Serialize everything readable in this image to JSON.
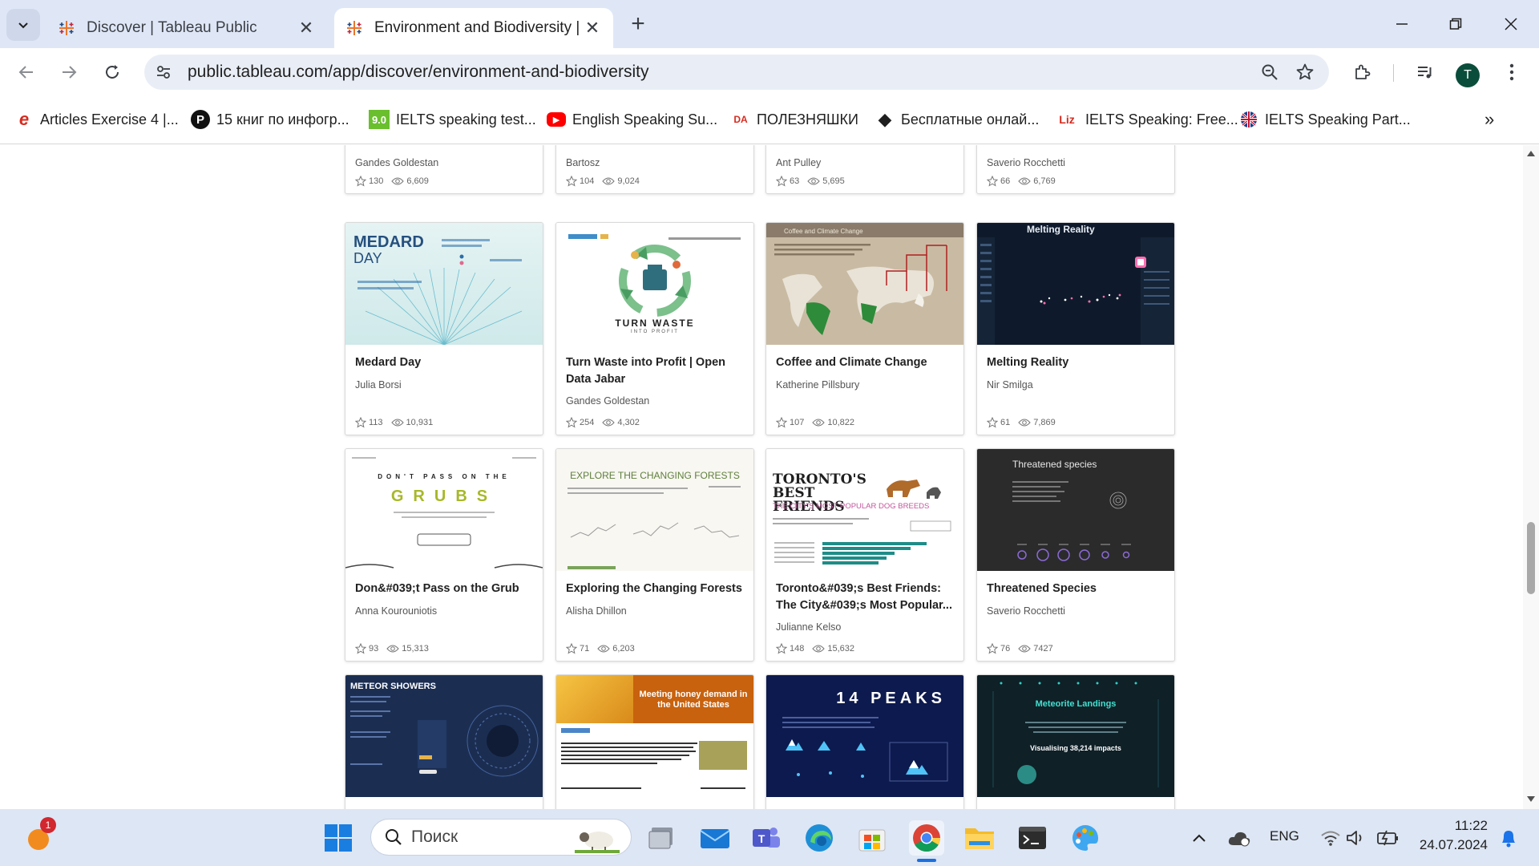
{
  "browser": {
    "tabs": [
      {
        "title": "Discover | Tableau Public",
        "active": false
      },
      {
        "title": "Environment and Biodiversity | T",
        "active": true
      }
    ],
    "url": "public.tableau.com/app/discover/environment-and-biodiversity",
    "avatar_letter": "T",
    "bookmarks": [
      {
        "label": "Articles Exercise 4 |...",
        "icon": "e",
        "color": "#d62b1f"
      },
      {
        "label": "15 книг по инфогр...",
        "icon": "P",
        "color": "#111111"
      },
      {
        "label": "IELTS speaking test...",
        "icon": "9.0",
        "color": "#6abf2e"
      },
      {
        "label": "English Speaking Su...",
        "icon": "▶",
        "color": "#ff0000"
      },
      {
        "label": "ПОЛЕЗНЯШКИ",
        "icon": "DA",
        "color": "#d62b1f"
      },
      {
        "label": "Бесплатные онлай...",
        "icon": "◆",
        "color": "#111111"
      },
      {
        "label": "IELTS Speaking: Free...",
        "icon": "Liz",
        "color": "#d62b1f"
      },
      {
        "label": "IELTS Speaking Part...",
        "icon": "🇬🇧",
        "color": "#1a3f8f"
      }
    ]
  },
  "gallery": {
    "row0": [
      {
        "author": "Gandes Goldestan",
        "favorites": "130",
        "views": "6,609"
      },
      {
        "author": "Bartosz",
        "favorites": "104",
        "views": "9,024"
      },
      {
        "author": "Ant Pulley",
        "favorites": "63",
        "views": "5,695"
      },
      {
        "author": "Saverio Rocchetti",
        "favorites": "66",
        "views": "6,769"
      }
    ],
    "row1": [
      {
        "title": "Medard Day",
        "author": "Julia Borsi",
        "favorites": "113",
        "views": "10,931",
        "thumb_title": "MEDARD",
        "thumb_sub": "DAY"
      },
      {
        "title": "Turn Waste into Profit | Open Data Jabar",
        "author": "Gandes Goldestan",
        "favorites": "254",
        "views": "4,302",
        "thumb_title": "TURN WASTE",
        "thumb_sub": "INTO PROFIT"
      },
      {
        "title": "Coffee and Climate Change",
        "author": "Katherine Pillsbury",
        "favorites": "107",
        "views": "10,822",
        "thumb_title": "Coffee and Climate Change"
      },
      {
        "title": "Melting Reality",
        "author": "Nir Smilga",
        "favorites": "61",
        "views": "7,869",
        "thumb_title": "Melting Reality"
      }
    ],
    "row2": [
      {
        "title": "Don&#039;t Pass on the Grub",
        "author": "Anna Kourouniotis",
        "favorites": "93",
        "views": "15,313",
        "thumb_title": "DON'T PASS ON THE",
        "thumb_sub": "GRUBS"
      },
      {
        "title": "Exploring the Changing Forests",
        "author": "Alisha Dhillon",
        "favorites": "71",
        "views": "6,203",
        "thumb_title": "EXPLORE THE CHANGING FORESTS"
      },
      {
        "title": "Toronto&#039;s Best Friends: The City&#039;s Most Popular...",
        "author": "Julianne Kelso",
        "favorites": "148",
        "views": "15,632",
        "thumb_title": "TORONTO'S BEST FRIENDS",
        "thumb_sub": "THE CITY'S MOST POPULAR DOG BREEDS"
      },
      {
        "title": "Threatened Species",
        "author": "Saverio Rocchetti",
        "favorites": "76",
        "views": "7427",
        "thumb_title": "Threatened species"
      }
    ],
    "row3": [
      {
        "thumb_title": "METEOR SHOWERS"
      },
      {
        "thumb_title": "Meeting honey demand in the United States"
      },
      {
        "thumb_title": "14 PEAKS"
      },
      {
        "thumb_title": "Meteorite Landings",
        "thumb_sub": "Visualising 38,214 impacts"
      }
    ]
  },
  "taskbar": {
    "search_placeholder": "Поиск",
    "notification_count": "1",
    "language": "ENG",
    "time": "11:22",
    "date": "24.07.2024"
  },
  "colors": {
    "tabstrip": "#dfe7f7",
    "omnibox": "#e9eef6",
    "taskbar": "#dde6f4",
    "card_border": "#d9d9d9"
  }
}
